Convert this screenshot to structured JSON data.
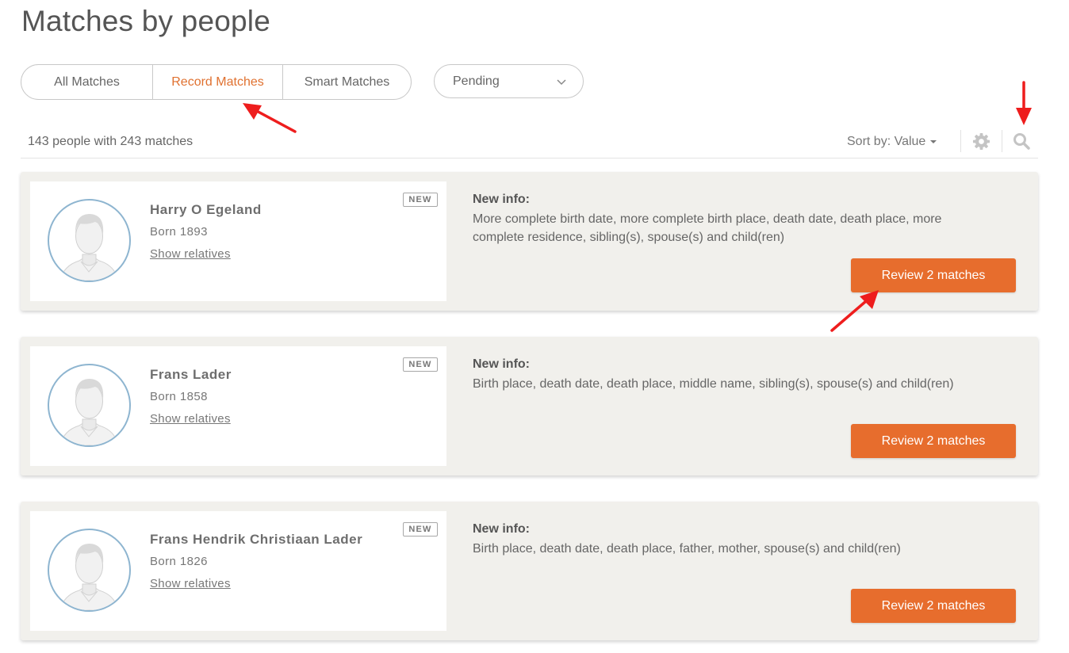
{
  "page_title": "Matches by people",
  "tabs": [
    {
      "label": "All Matches",
      "active": false
    },
    {
      "label": "Record Matches",
      "active": true
    },
    {
      "label": "Smart Matches",
      "active": false
    }
  ],
  "status_filter": {
    "value": "Pending",
    "icon": "chevron-down-icon"
  },
  "summary": "143 people with 243 matches",
  "sort": {
    "label": "Sort by:",
    "value": "Value"
  },
  "toolbar_icons": [
    "gear-icon",
    "search-icon"
  ],
  "accent_color": "#e76d2d",
  "cards": [
    {
      "name": "Harry O Egeland",
      "born": "Born 1893",
      "relatives_link": "Show relatives",
      "badge": "NEW",
      "info_label": "New info:",
      "info_text": "More complete birth date, more complete birth place, death date, death place, more complete residence, sibling(s), spouse(s) and child(ren)",
      "button": "Review 2 matches"
    },
    {
      "name": "Frans Lader",
      "born": "Born 1858",
      "relatives_link": "Show relatives",
      "badge": "NEW",
      "info_label": "New info:",
      "info_text": "Birth place, death date, death place, middle name, sibling(s), spouse(s) and child(ren)",
      "button": "Review 2 matches"
    },
    {
      "name": "Frans Hendrik Christiaan Lader",
      "born": "Born 1826",
      "relatives_link": "Show relatives",
      "badge": "NEW",
      "info_label": "New info:",
      "info_text": "Birth place, death date, death place, father, mother, spouse(s) and child(ren)",
      "button": "Review 2 matches"
    }
  ],
  "annotations": [
    "red-arrow-icon",
    "red-arrow-icon",
    "red-arrow-icon"
  ]
}
